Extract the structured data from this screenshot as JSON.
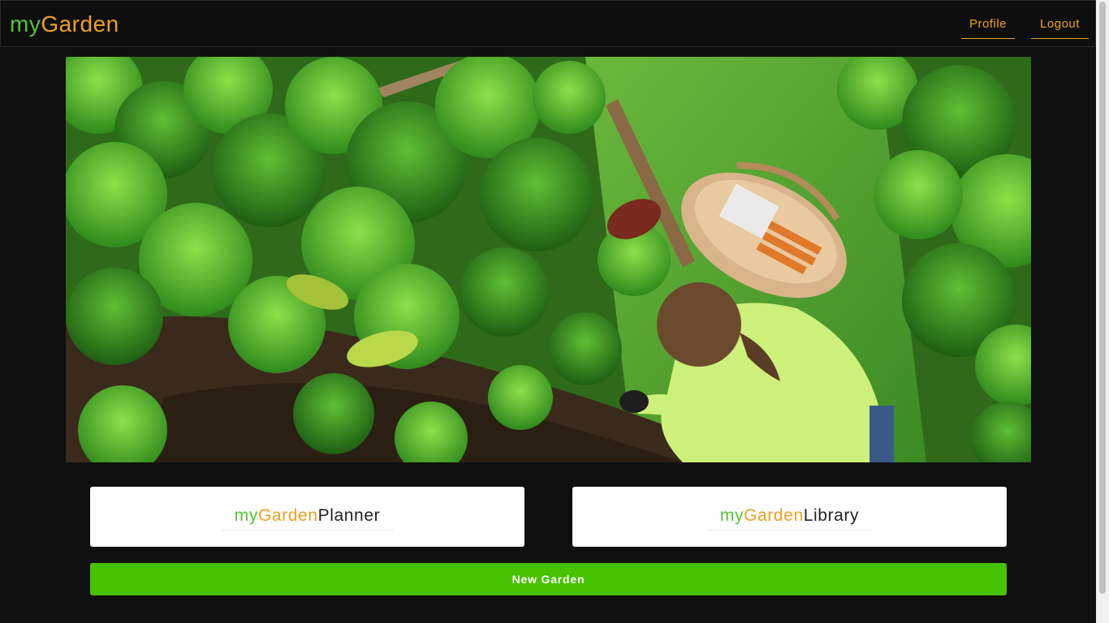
{
  "header": {
    "logo": {
      "part1": "my",
      "part2": "Garden"
    },
    "nav": [
      {
        "label": "Profile"
      },
      {
        "label": "Logout"
      }
    ]
  },
  "cards": [
    {
      "part1": "my",
      "part2": "Garden",
      "part3": "Planner"
    },
    {
      "part1": "my",
      "part2": "Garden",
      "part3": "Library"
    }
  ],
  "actions": {
    "new_garden_label": "New Garden"
  },
  "colors": {
    "background": "#0f0f0f",
    "brand_green": "#55c23a",
    "brand_orange": "#f0a020",
    "button_green": "#47c200",
    "card_bg": "#ffffff"
  },
  "hero": {
    "icon": "garden-photo"
  }
}
